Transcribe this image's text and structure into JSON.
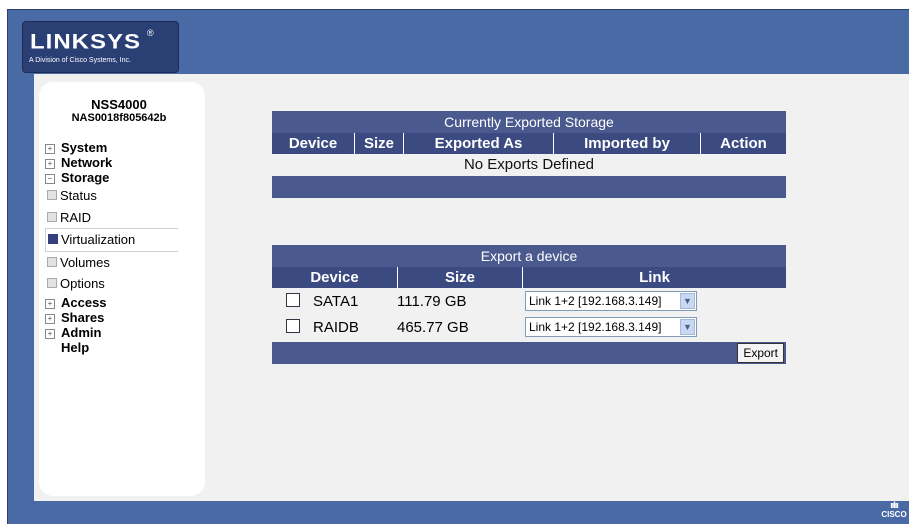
{
  "header": {
    "logo_text": "LINKSYS",
    "logo_reg": "®",
    "logo_subtitle": "A Division of Cisco Systems, Inc.",
    "help_label": "?"
  },
  "sidebar": {
    "device_name": "NSS4000",
    "device_id": "NAS0018f805642b",
    "sections": [
      {
        "label": "System",
        "expander": "+"
      },
      {
        "label": "Network",
        "expander": "+"
      },
      {
        "label": "Storage",
        "expander": "−"
      }
    ],
    "storage_items": [
      "Status",
      "RAID",
      "Virtualization",
      "Volumes",
      "Options"
    ],
    "active_item": "Virtualization",
    "sections_after": [
      {
        "label": "Access",
        "expander": "+"
      },
      {
        "label": "Shares",
        "expander": "+"
      },
      {
        "label": "Admin",
        "expander": "+"
      }
    ],
    "help": "Help"
  },
  "exported": {
    "title": "Currently Exported Storage",
    "columns": [
      "Device",
      "Size",
      "Exported As",
      "Imported by",
      "Action"
    ],
    "empty_message": "No Exports Defined"
  },
  "export_device": {
    "title": "Export a device",
    "columns": [
      "Device",
      "Size",
      "Link"
    ],
    "rows": [
      {
        "device": "SATA1",
        "size": "111.79 GB",
        "link": "Link 1+2 [192.168.3.149]",
        "checked": false
      },
      {
        "device": "RAIDB",
        "size": "465.77 GB",
        "link": "Link 1+2 [192.168.3.149]",
        "checked": false
      }
    ],
    "button_label": "Export"
  },
  "footer": {
    "cisco_text": "CISCO"
  },
  "colors": {
    "frame_blue": "#4a6aa6",
    "table_header": "#3b4a80",
    "table_title": "#4a5a8e",
    "active_nav": "#36407f"
  }
}
